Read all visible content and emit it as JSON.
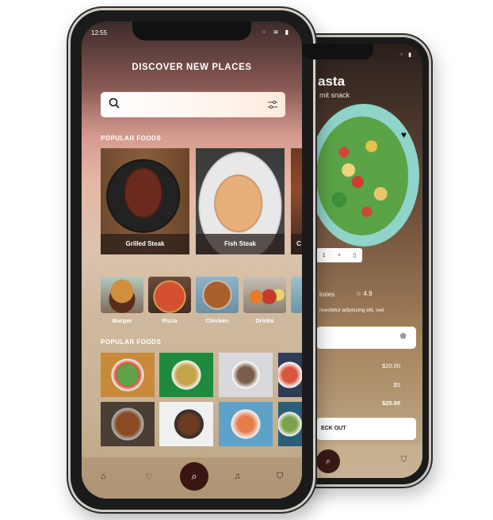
{
  "back_phone": {
    "title": "asta",
    "subtitle": "mit snack",
    "quantity": {
      "value": "1",
      "plus": "+",
      "minus": "-"
    },
    "calories_label": "lories",
    "rating": "4.9",
    "description": "nsectetur adipiscing elit, sed",
    "prices": [
      {
        "value": "$20.00"
      },
      {
        "value": "$5"
      },
      {
        "value": "$25.00"
      }
    ],
    "checkout_label": "ECK OUT"
  },
  "front_phone": {
    "status": {
      "time": "12:55"
    },
    "page_title": "DISCOVER NEW PLACES",
    "search": {
      "placeholder": ""
    },
    "popular_foods_label_1": "POPULAR FOODS",
    "popular_foods_label_2": "POPULAR FOODS",
    "featured": [
      {
        "label": "Grilled Steak"
      },
      {
        "label": "Fish Steak"
      },
      {
        "label": "C"
      }
    ],
    "categories": [
      {
        "label": "Burger"
      },
      {
        "label": "Pizza"
      },
      {
        "label": "Chicken"
      },
      {
        "label": "Drinks"
      }
    ]
  },
  "icons": {
    "heart": "heart-icon",
    "star": "star-icon",
    "tag": "tag-icon",
    "search": "search-icon",
    "filter": "filter-icon",
    "home": "home-icon",
    "bell": "bell-icon",
    "basket": "basket-icon"
  }
}
